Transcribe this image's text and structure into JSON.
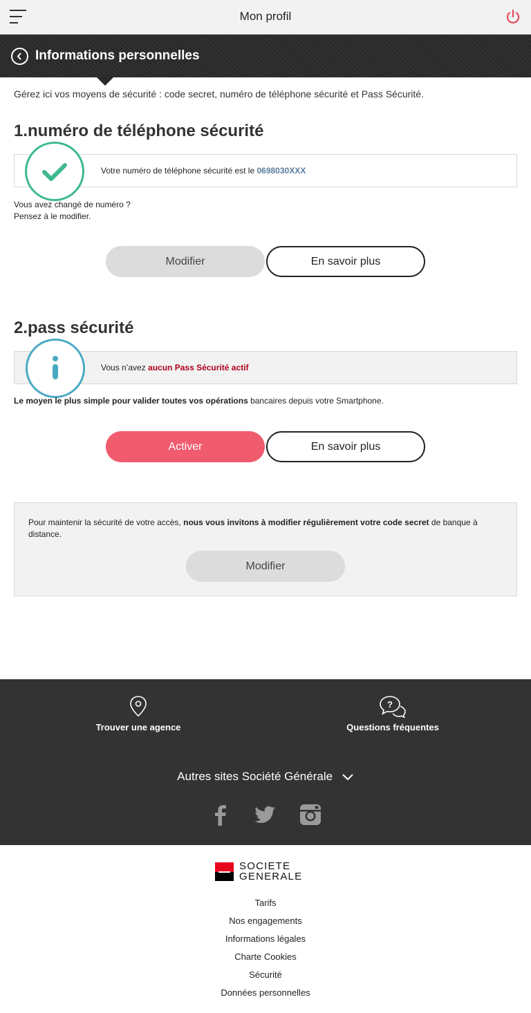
{
  "topbar": {
    "title": "Mon profil",
    "menu_icon": "hamburger-icon",
    "power_icon": "power-icon",
    "power_color": "#e9485e"
  },
  "header": {
    "title": "Informations personnelles",
    "back_icon": "back-arrow-icon"
  },
  "intro": "Gérez ici vos moyens de sécurité : code secret, numéro de téléphone sécurité et Pass Sécurité.",
  "phone_section": {
    "title": "1.numéro de téléphone sécurité",
    "status_text": "Votre numéro de téléphone sécurité est le ",
    "phone_value": "0698030XXX",
    "note_line1": "Vous avez changé de numéro ?",
    "note_line2": "Pensez à le modifier.",
    "modify_label": "Modifier",
    "learn_more_label": "En savoir plus",
    "status_icon": "check-icon",
    "status_color": "#3db98e"
  },
  "pass_section": {
    "title": "2.pass sécurité",
    "status_prefix": "Vous n’avez ",
    "status_highlight": "aucun Pass Sécurité actif",
    "desc_bold": "Le moyen le plus simple pour valider toutes vos opérations",
    "desc_rest": " bancaires depuis votre Smartphone.",
    "activate_label": "Activer",
    "learn_more_label": "En savoir plus",
    "status_icon": "info-icon",
    "status_color": "#4aa9c2"
  },
  "code_section": {
    "text_prefix": "Pour maintenir la sécurité de votre accès, ",
    "text_bold": "nous vous invitons à modifier régulièrement votre code secret",
    "text_suffix": " de banque à distance.",
    "modify_label": "Modifier"
  },
  "footer": {
    "agency_label": "Trouver une agence",
    "agency_icon": "location-pin-icon",
    "faq_label": "Questions fréquentes",
    "faq_icon": "chat-question-icon",
    "other_sites_label": "Autres sites Société Générale",
    "socials": [
      "facebook-icon",
      "twitter-icon",
      "instagram-icon"
    ]
  },
  "brand": {
    "line1": "SOCIETE",
    "line2": "GENERALE",
    "red": "#e9041e"
  },
  "bottom_links": [
    "Tarifs",
    "Nos engagements",
    "Informations légales",
    "Charte Cookies",
    "Sécurité",
    "Données personnelles"
  ]
}
